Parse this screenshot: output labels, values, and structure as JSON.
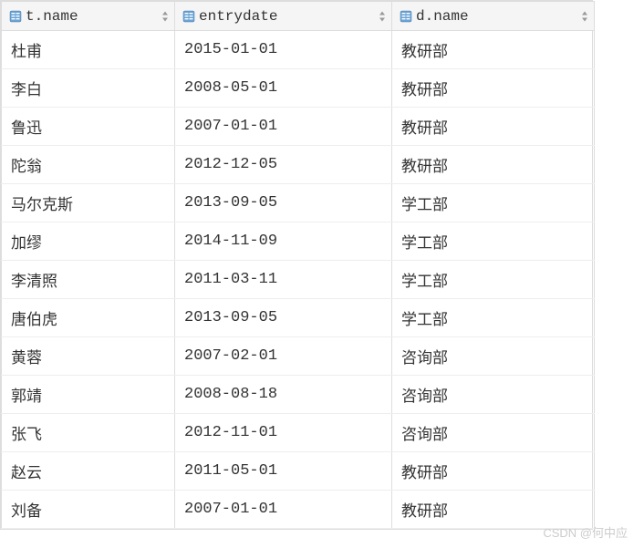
{
  "table": {
    "columns": [
      {
        "label": "t.name"
      },
      {
        "label": "entrydate"
      },
      {
        "label": "d.name"
      }
    ],
    "rows": [
      {
        "tname": "杜甫",
        "entrydate": "2015-01-01",
        "dname": "教研部"
      },
      {
        "tname": "李白",
        "entrydate": "2008-05-01",
        "dname": "教研部"
      },
      {
        "tname": "鲁迅",
        "entrydate": "2007-01-01",
        "dname": "教研部"
      },
      {
        "tname": "陀翁",
        "entrydate": "2012-12-05",
        "dname": "教研部"
      },
      {
        "tname": "马尔克斯",
        "entrydate": "2013-09-05",
        "dname": "学工部"
      },
      {
        "tname": "加缪",
        "entrydate": "2014-11-09",
        "dname": "学工部"
      },
      {
        "tname": "李清照",
        "entrydate": "2011-03-11",
        "dname": "学工部"
      },
      {
        "tname": "唐伯虎",
        "entrydate": "2013-09-05",
        "dname": "学工部"
      },
      {
        "tname": "黄蓉",
        "entrydate": "2007-02-01",
        "dname": "咨询部"
      },
      {
        "tname": "郭靖",
        "entrydate": "2008-08-18",
        "dname": "咨询部"
      },
      {
        "tname": "张飞",
        "entrydate": "2012-11-01",
        "dname": "咨询部"
      },
      {
        "tname": "赵云",
        "entrydate": "2011-05-01",
        "dname": "教研部"
      },
      {
        "tname": "刘备",
        "entrydate": "2007-01-01",
        "dname": "教研部"
      }
    ]
  },
  "watermark": "CSDN @何中应"
}
